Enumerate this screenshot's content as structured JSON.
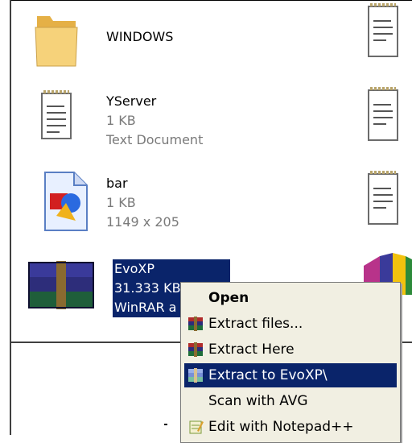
{
  "files": [
    {
      "name": "WINDOWS",
      "details": []
    },
    {
      "name": "YServer",
      "details": [
        "1 KB",
        "Text Document"
      ]
    },
    {
      "name": "bar",
      "details": [
        "1 KB",
        "1149 x 205"
      ]
    },
    {
      "name": "EvoXP",
      "details": [
        "31.333 KB",
        "WinRAR a"
      ]
    }
  ],
  "context_menu": {
    "items": [
      {
        "label": "Open",
        "icon": "none"
      },
      {
        "label": "Extract files...",
        "icon": "winrar-icon"
      },
      {
        "label": "Extract Here",
        "icon": "winrar-icon"
      },
      {
        "label": "Extract to EvoXP\\",
        "icon": "winrar-icon"
      },
      {
        "label": "Scan with AVG",
        "icon": "none"
      },
      {
        "label": "Edit with Notepad++",
        "icon": "notepadpp-icon"
      }
    ],
    "highlighted_index": 3
  },
  "colors": {
    "selection": "#0a246a",
    "menu_bg": "#f1efe2",
    "folder": "#f2c865"
  }
}
